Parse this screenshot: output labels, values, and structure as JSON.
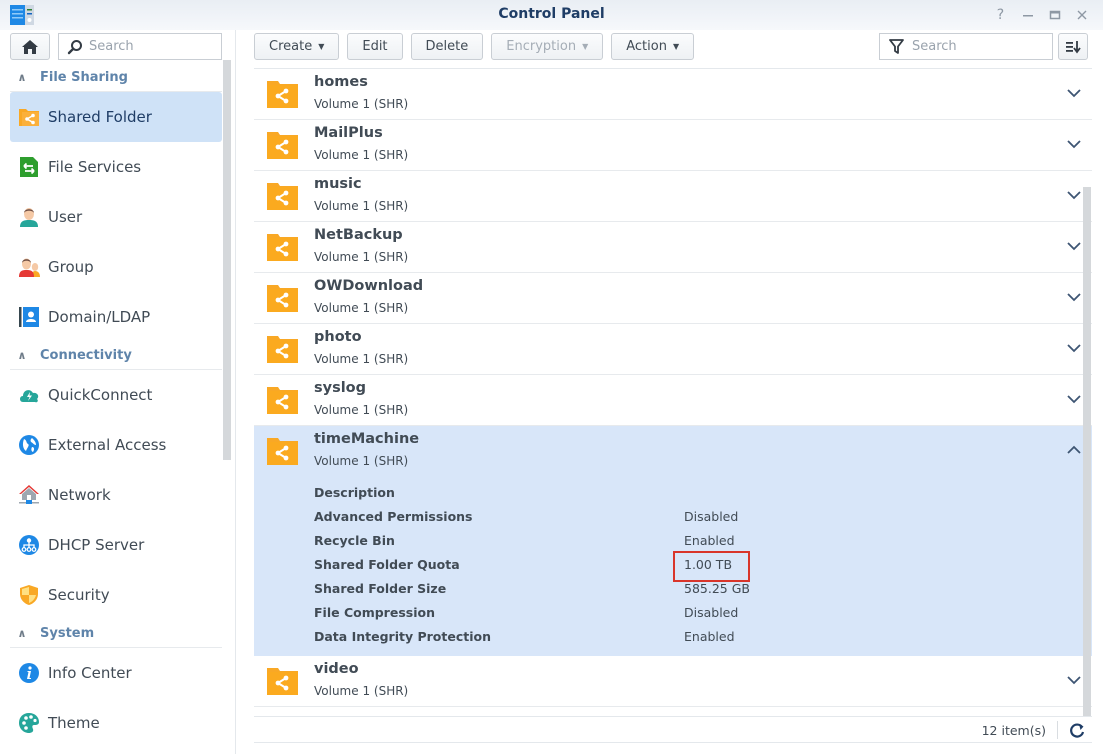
{
  "window": {
    "title": "Control Panel",
    "controls": [
      "help-icon",
      "minimize-icon",
      "maximize-icon",
      "close-icon"
    ]
  },
  "sidebar": {
    "search_placeholder": "Search",
    "sections": [
      {
        "title": "File Sharing",
        "items": [
          {
            "label": "Shared Folder",
            "icon": "shared-folder-icon",
            "active": true
          },
          {
            "label": "File Services",
            "icon": "file-services-icon"
          },
          {
            "label": "User",
            "icon": "user-icon"
          },
          {
            "label": "Group",
            "icon": "group-icon"
          },
          {
            "label": "Domain/LDAP",
            "icon": "domain-ldap-icon"
          }
        ]
      },
      {
        "title": "Connectivity",
        "items": [
          {
            "label": "QuickConnect",
            "icon": "quickconnect-icon"
          },
          {
            "label": "External Access",
            "icon": "external-access-icon"
          },
          {
            "label": "Network",
            "icon": "network-icon"
          },
          {
            "label": "DHCP Server",
            "icon": "dhcp-server-icon"
          },
          {
            "label": "Security",
            "icon": "security-icon"
          }
        ]
      },
      {
        "title": "System",
        "items": [
          {
            "label": "Info Center",
            "icon": "info-center-icon"
          },
          {
            "label": "Theme",
            "icon": "theme-icon"
          }
        ]
      }
    ]
  },
  "toolbar": {
    "create": "Create",
    "edit": "Edit",
    "delete": "Delete",
    "encryption": "Encryption",
    "action": "Action",
    "search_placeholder": "Search"
  },
  "folders": [
    {
      "name": "homes",
      "volume": "Volume 1 (SHR)"
    },
    {
      "name": "MailPlus",
      "volume": "Volume 1 (SHR)"
    },
    {
      "name": "music",
      "volume": "Volume 1 (SHR)"
    },
    {
      "name": "NetBackup",
      "volume": "Volume 1 (SHR)"
    },
    {
      "name": "OWDownload",
      "volume": "Volume 1 (SHR)"
    },
    {
      "name": "photo",
      "volume": "Volume 1 (SHR)"
    },
    {
      "name": "syslog",
      "volume": "Volume 1 (SHR)"
    },
    {
      "name": "timeMachine",
      "volume": "Volume 1 (SHR)",
      "expanded": true,
      "details": [
        {
          "label": "Description",
          "value": ""
        },
        {
          "label": "Advanced Permissions",
          "value": "Disabled"
        },
        {
          "label": "Recycle Bin",
          "value": "Enabled"
        },
        {
          "label": "Shared Folder Quota",
          "value": "1.00 TB",
          "highlight": true
        },
        {
          "label": "Shared Folder Size",
          "value": "585.25 GB"
        },
        {
          "label": "File Compression",
          "value": "Disabled"
        },
        {
          "label": "Data Integrity Protection",
          "value": "Enabled"
        }
      ]
    },
    {
      "name": "video",
      "volume": "Volume 1 (SHR)"
    }
  ],
  "status": {
    "item_count": "12 item(s)"
  },
  "colors": {
    "accent": "#1f3d66",
    "section_header": "#5f84aa",
    "selected_bg": "#cfe2f7",
    "expanded_bg": "#d8e6f9",
    "folder": "#f9a825",
    "highlight_border": "#d9352b"
  }
}
